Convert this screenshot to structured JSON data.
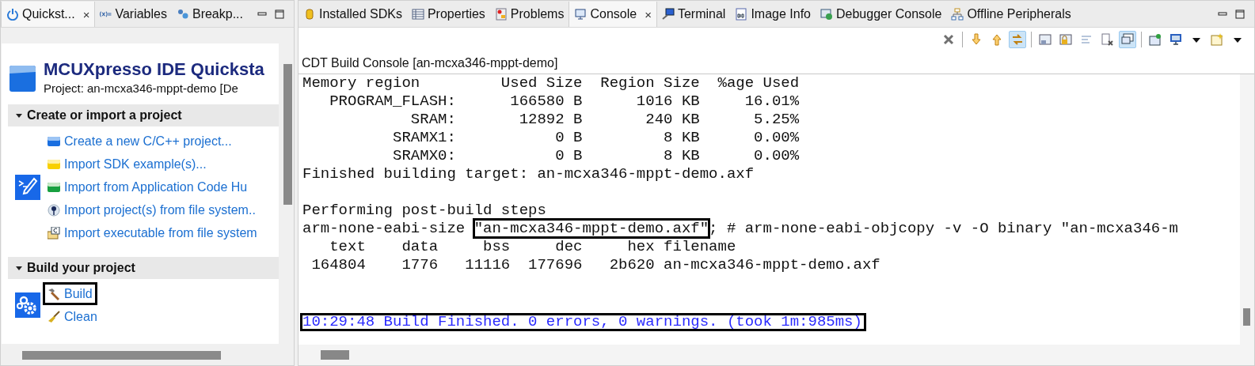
{
  "left_panel": {
    "tabs": [
      {
        "label": "Quickst...",
        "selected": true,
        "close": "×"
      },
      {
        "label": "Variables",
        "selected": false
      },
      {
        "label": "Breakp...",
        "selected": false
      }
    ],
    "quickstart": {
      "title": "MCUXpresso IDE Quicksta",
      "project": "Project: an-mcxa346-mppt-demo [De",
      "sections": [
        {
          "title": "Create or import a project",
          "expanded": true,
          "items": [
            {
              "label": "Create a new C/C++ project...",
              "highlighted": false
            },
            {
              "label": "Import SDK example(s)...",
              "highlighted": false
            },
            {
              "label": "Import from Application Code Hu",
              "highlighted": false
            },
            {
              "label": "Import project(s) from file system..",
              "highlighted": false
            },
            {
              "label": "Import executable from file system",
              "highlighted": false
            }
          ]
        },
        {
          "title": "Build your project",
          "expanded": true,
          "items": [
            {
              "label": "Build",
              "highlighted": true
            },
            {
              "label": "Clean",
              "highlighted": false
            }
          ]
        }
      ]
    }
  },
  "right_panel": {
    "tabs": [
      {
        "label": "Installed SDKs",
        "selected": false
      },
      {
        "label": "Properties",
        "selected": false
      },
      {
        "label": "Problems",
        "selected": false
      },
      {
        "label": "Console",
        "selected": true,
        "close": "×"
      },
      {
        "label": "Terminal",
        "selected": false
      },
      {
        "label": "Image Info",
        "selected": false
      },
      {
        "label": "Debugger Console",
        "selected": false
      },
      {
        "label": "Offline Peripherals",
        "selected": false
      }
    ],
    "toolbar": [
      {
        "kind": "remove",
        "pressed": false
      },
      {
        "kind": "sep"
      },
      {
        "kind": "down",
        "pressed": false
      },
      {
        "kind": "up",
        "pressed": false
      },
      {
        "kind": "swap",
        "pressed": true
      },
      {
        "kind": "sep"
      },
      {
        "kind": "save",
        "pressed": false
      },
      {
        "kind": "lock",
        "pressed": false
      },
      {
        "kind": "lines",
        "pressed": false
      },
      {
        "kind": "clear",
        "pressed": false
      },
      {
        "kind": "chat",
        "pressed": true
      },
      {
        "kind": "sep"
      },
      {
        "kind": "pin",
        "pressed": false
      },
      {
        "kind": "monitor",
        "pressed": false
      },
      {
        "kind": "dropdown",
        "pressed": false
      },
      {
        "kind": "newconsole",
        "pressed": false
      },
      {
        "kind": "dropdown",
        "pressed": false
      }
    ],
    "console_title": "CDT Build Console [an-mcxa346-mppt-demo]",
    "lines": [
      {
        "kind": "output",
        "segments": [
          {
            "text": "Memory region         Used Size  Region Size  %age Used"
          }
        ]
      },
      {
        "kind": "output",
        "segments": [
          {
            "text": "   PROGRAM_FLASH:      166580 B      1016 KB     16.01%"
          }
        ]
      },
      {
        "kind": "output",
        "segments": [
          {
            "text": "            SRAM:       12892 B       240 KB      5.25%"
          }
        ]
      },
      {
        "kind": "output",
        "segments": [
          {
            "text": "          SRAMX1:           0 B         8 KB      0.00%"
          }
        ]
      },
      {
        "kind": "output",
        "segments": [
          {
            "text": "          SRAMX0:           0 B         8 KB      0.00%"
          }
        ]
      },
      {
        "kind": "output",
        "segments": [
          {
            "text": "Finished building target: an-mcxa346-mppt-demo.axf"
          }
        ]
      },
      {
        "kind": "blank"
      },
      {
        "kind": "output",
        "segments": [
          {
            "text": "Performing post-build steps"
          }
        ]
      },
      {
        "kind": "output",
        "segments": [
          {
            "text": "arm-none-eabi-size "
          },
          {
            "text": "\"an-mcxa346-mppt-demo.axf\"",
            "highlighted": true
          },
          {
            "text": "; # arm-none-eabi-objcopy -v -O binary \"an-mcxa346-m"
          }
        ]
      },
      {
        "kind": "output",
        "segments": [
          {
            "text": "   text\t   data\t    bss\t    dec\t    hex\tfilename"
          }
        ]
      },
      {
        "kind": "output",
        "segments": [
          {
            "text": " 164804\t   1776\t  11116\t 177696\t  2b620\tan-mcxa346-mppt-demo.axf"
          }
        ]
      },
      {
        "kind": "blank"
      },
      {
        "kind": "blank"
      },
      {
        "kind": "status",
        "highlighted": true,
        "segments": [
          {
            "text": "10:29:48 Build Finished. 0 errors, 0 warnings. (took 1m:985ms)"
          }
        ]
      }
    ]
  }
}
